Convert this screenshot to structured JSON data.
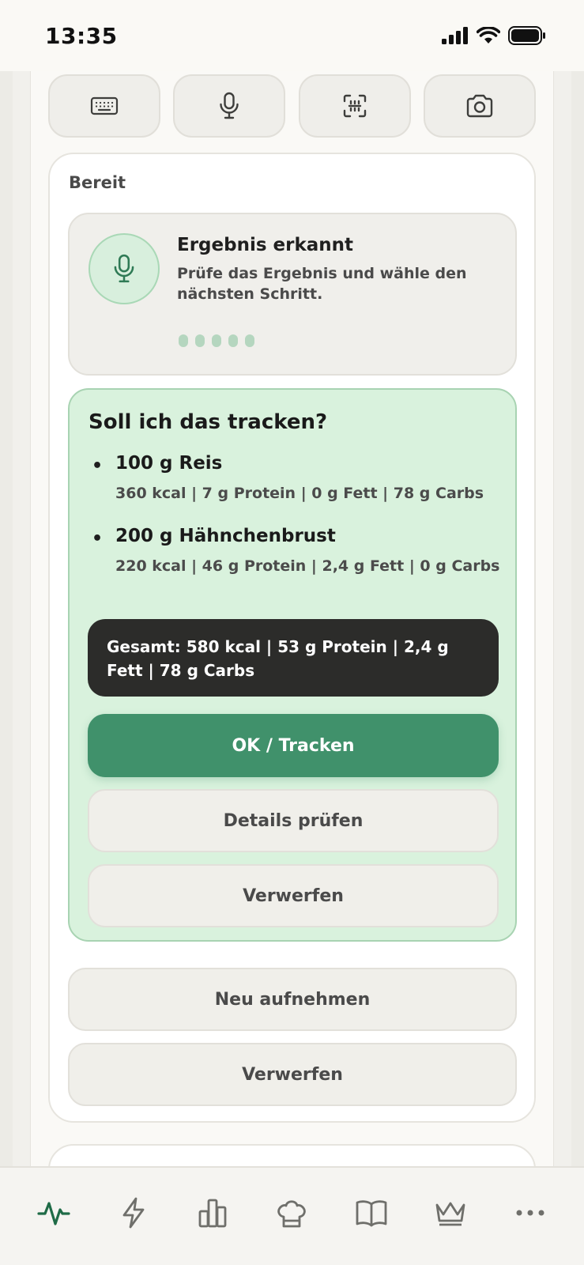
{
  "status_bar": {
    "time": "13:35"
  },
  "input_modes": [
    {
      "icon": "keyboard-icon"
    },
    {
      "icon": "microphone-icon"
    },
    {
      "icon": "scan-icon"
    },
    {
      "icon": "camera-icon"
    }
  ],
  "card": {
    "status": "Bereit",
    "result": {
      "title": "Ergebnis erkannt",
      "text": "Prüfe das Ergebnis und wähle den nächsten Schritt."
    },
    "confirm": {
      "title": "Soll ich das tracken?",
      "items": [
        {
          "name": "100 g Reis",
          "macros": "360 kcal | 7 g Protein | 0 g Fett | 78 g Carbs"
        },
        {
          "name": "200 g Hähnchenbrust",
          "macros": "220 kcal | 46 g Protein | 2,4 g Fett | 0 g Carbs"
        }
      ],
      "total": "Gesamt: 580 kcal | 53 g Protein | 2,4 g Fett | 78 g Carbs",
      "ok_label": "OK / Tracken",
      "details_label": "Details prüfen",
      "discard_label": "Verwerfen"
    },
    "retake_label": "Neu aufnehmen",
    "discard_label": "Verwerfen"
  },
  "tabs": [
    {
      "icon": "activity-icon",
      "active": true
    },
    {
      "icon": "lightning-icon",
      "active": false
    },
    {
      "icon": "bar-chart-icon",
      "active": false
    },
    {
      "icon": "chef-hat-icon",
      "active": false
    },
    {
      "icon": "book-icon",
      "active": false
    },
    {
      "icon": "crown-icon",
      "active": false
    },
    {
      "icon": "more-icon",
      "active": false
    }
  ],
  "colors": {
    "accent": "#40916b",
    "confirm_bg": "#d9f2dd",
    "total_bg": "#2c2c2a",
    "active_tab": "#1f6b47",
    "inactive_tab": "#6f6f6b"
  }
}
